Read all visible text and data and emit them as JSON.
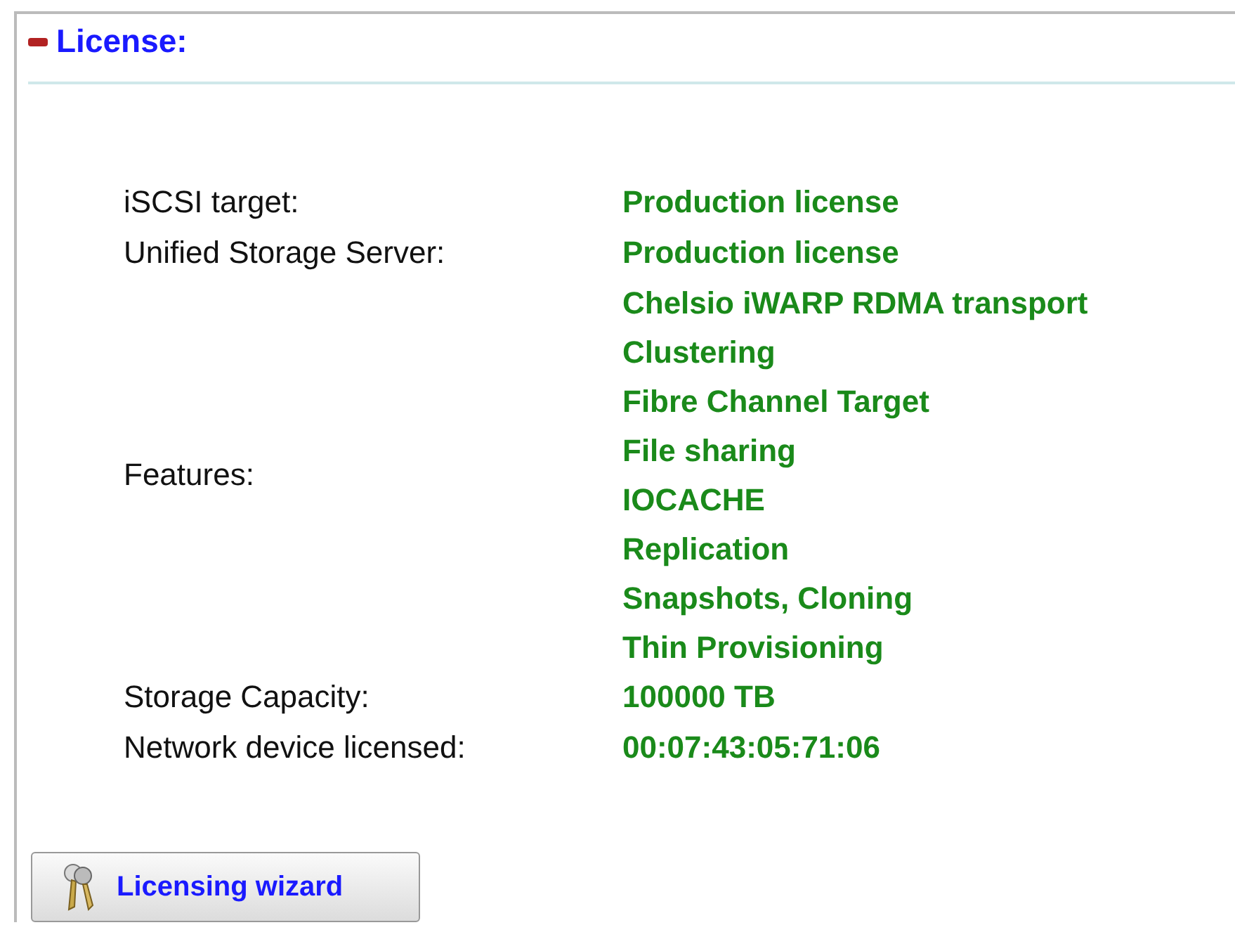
{
  "section": {
    "title": "License:",
    "expanded": true
  },
  "rows": [
    {
      "kind": "text",
      "label": "iSCSI target:",
      "value": "Production license"
    },
    {
      "kind": "text",
      "label": "Unified Storage Server:",
      "value": "Production license"
    },
    {
      "kind": "list",
      "label": "Features:",
      "values": [
        "Chelsio iWARP RDMA transport",
        "Clustering",
        "Fibre Channel Target",
        "File sharing",
        "IOCACHE",
        "Replication",
        "Snapshots, Cloning",
        "Thin Provisioning"
      ]
    },
    {
      "kind": "text",
      "label": "Storage Capacity:",
      "value": "100000 TB"
    },
    {
      "kind": "text",
      "label": "Network device licensed:",
      "value": "00:07:43:05:71:06"
    }
  ],
  "button": {
    "label": "Licensing wizard"
  }
}
